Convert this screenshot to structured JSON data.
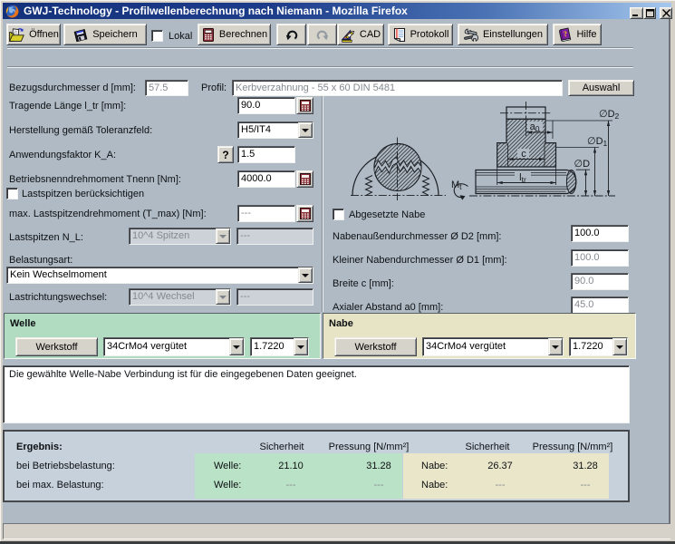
{
  "window": {
    "title": "GWJ-Technology - Profilwellenberechnung nach Niemann - Mozilla Firefox"
  },
  "toolbar": {
    "open": "Öffnen",
    "save": "Speichern",
    "lokal": "Lokal",
    "berechnen": "Berechnen",
    "cad": "CAD",
    "protokoll": "Protokoll",
    "einstellungen": "Einstellungen",
    "hilfe": "Hilfe"
  },
  "form": {
    "bezugsdurchmesser_label": "Bezugsdurchmesser d [mm]:",
    "bezugsdurchmesser_value": "57.5",
    "profil_label": "Profil:",
    "profil_value": "Kerbverzahnung - 55 x 60 DIN 5481",
    "auswahl_button": "Auswahl",
    "tragende_laenge_label": "Tragende Länge l_tr [mm]:",
    "tragende_laenge_value": "90.0",
    "herstellung_label": "Herstellung gemäß Toleranzfeld:",
    "herstellung_value": "H5/IT4",
    "anwendungsfaktor_label": "Anwendungsfaktor K_A:",
    "anwendungsfaktor_value": "1.5",
    "hilfe_button": "?",
    "betriebsmoment_label": "Betriebsnenndrehmoment Tnenn [Nm]:",
    "betriebsmoment_value": "4000.0",
    "lastspitzen_check_label": "Lastspitzen berücksichtigen",
    "max_lastspitzen_label": "max. Lastspitzendrehmoment (T_max) [Nm]:",
    "max_lastspitzen_value": "---",
    "lastspitzen_nl_label": "Lastspitzen N_L:",
    "lastspitzen_nl_select": "10^4 Spitzen",
    "lastspitzen_nl_value": "---",
    "belastungsart_label": "Belastungsart:",
    "belastungsart_value": "Kein Wechselmoment",
    "lastrichtung_label": "Lastrichtungswechsel:",
    "lastrichtung_select": "10^4 Wechsel",
    "lastrichtung_value": "---"
  },
  "nabe_form": {
    "abgesetzte_check_label": "Abgesetzte Nabe",
    "d2_label": "Nabenaußendurchmesser Ø D2 [mm]:",
    "d2_value": "100.0",
    "d1_label": "Kleiner Nabendurchmesser Ø D1 [mm]:",
    "d1_value": "100.0",
    "breite_label": "Breite c [mm]:",
    "breite_value": "90.0",
    "abstand_label": "Axialer Abstand a0 [mm]:",
    "abstand_value": "45.0"
  },
  "drawing": {
    "d2_main": "∅D",
    "d2_sub": "2",
    "d1_main": "∅D",
    "d1_sub": "1",
    "d_main": "∅D",
    "a0_main": "a",
    "a0_sub": "0",
    "c_label": "c",
    "ltr_main": "l",
    "ltr_sub": "tr",
    "mt_main": "M",
    "mt_sub": "t"
  },
  "welle_panel": {
    "title": "Welle",
    "werkstoff_button": "Werkstoff",
    "material": "34CrMo4 vergütet",
    "material_number": "1.7220"
  },
  "nabe_panel": {
    "title": "Nabe",
    "werkstoff_button": "Werkstoff",
    "material": "34CrMo4 vergütet",
    "material_number": "1.7220"
  },
  "message": "Die gewählte Welle-Nabe Verbindung ist für die eingegebenen Daten geeignet.",
  "results": {
    "title": "Ergebnis:",
    "col_sicherheit": "Sicherheit",
    "col_pressung": "Pressung [N/mm²]",
    "row_betrieb": "bei Betriebsbelastung:",
    "row_max": "bei max. Belastung:",
    "welle_label": "Welle:",
    "nabe_label": "Nabe:",
    "welle_betrieb_sicherheit": "21.10",
    "welle_betrieb_pressung": "31.28",
    "nabe_betrieb_sicherheit": "26.37",
    "nabe_betrieb_pressung": "31.28",
    "welle_max_sicherheit": "---",
    "welle_max_pressung": "---",
    "nabe_max_sicherheit": "---",
    "nabe_max_pressung": "---"
  },
  "colors": {
    "titlebar_left": "#15327c",
    "titlebar_right": "#a6c8ee",
    "page_background": "#afbac4",
    "button_face": "#d6d3cb",
    "welle_green": "#b1dcc1",
    "nabe_tan": "#e7e4c6",
    "results_panel": "#c7d1dc",
    "result_green": "#bae2c6",
    "result_tan": "#e9e6c9",
    "statusbar": "#d6d2ca"
  }
}
